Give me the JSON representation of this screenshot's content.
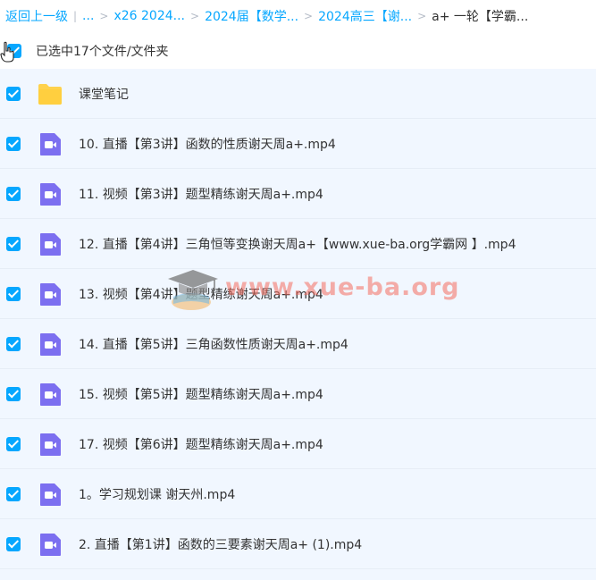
{
  "breadcrumb": {
    "back": "返回上一级",
    "bar": "|",
    "ellipsis": "...",
    "items": [
      "x26 2024...",
      "2024届【数学...",
      "2024高三【谢..."
    ],
    "current": "a+ 一轮【学霸..."
  },
  "selection": {
    "text": "已选中17个文件/文件夹"
  },
  "files": [
    {
      "name": "课堂笔记",
      "type": "folder"
    },
    {
      "name": "10. 直播【第3讲】函数的性质谢天周a+.mp4",
      "type": "video"
    },
    {
      "name": "11. 视频【第3讲】题型精练谢天周a+.mp4",
      "type": "video"
    },
    {
      "name": "12. 直播【第4讲】三角恒等变换谢天周a+【www.xue-ba.org学霸网 】.mp4",
      "type": "video"
    },
    {
      "name": "13. 视频【第4讲】题型精练谢天周a+.mp4",
      "type": "video"
    },
    {
      "name": "14. 直播【第5讲】三角函数性质谢天周a+.mp4",
      "type": "video"
    },
    {
      "name": "15. 视频【第5讲】题型精练谢天周a+.mp4",
      "type": "video"
    },
    {
      "name": "17. 视频【第6讲】题型精练谢天周a+.mp4",
      "type": "video"
    },
    {
      "name": "1。学习规划课 谢天州.mp4",
      "type": "video"
    },
    {
      "name": "2. 直播【第1讲】函数的三要素谢天周a+ (1).mp4",
      "type": "video"
    }
  ],
  "watermark": {
    "text": "www.xue-ba.org"
  },
  "colors": {
    "accent": "#06a7ff",
    "folder": "#ffd24d",
    "video": "#7c6ff0",
    "row_bg": "#f1f7ff"
  }
}
